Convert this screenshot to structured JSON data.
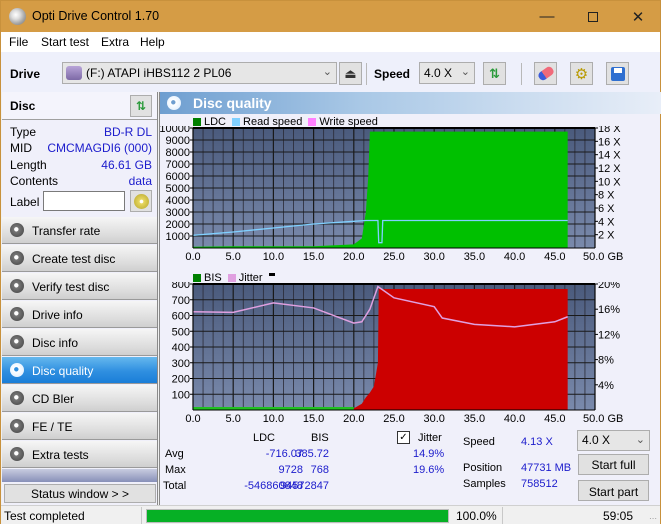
{
  "window": {
    "title": "Opti Drive Control 1.70",
    "controls": [
      "minimize",
      "maximize",
      "close"
    ]
  },
  "menu": [
    "File",
    "Start test",
    "Extra",
    "Help"
  ],
  "toolbar": {
    "drive_label": "Drive",
    "drive_value": "(F:)  ATAPI iHBS112  2 PL06",
    "speed_label": "Speed",
    "speed_value": "4.0 X",
    "icons": [
      "eject-icon",
      "refresh-icon",
      "erase-icon",
      "settings-icon",
      "save-icon"
    ]
  },
  "disc": {
    "header": "Disc",
    "rows": [
      {
        "key": "Type",
        "value": "BD-R DL"
      },
      {
        "key": "MID",
        "value": "CMCMAGDI6 (000)"
      },
      {
        "key": "Length",
        "value": "46.61 GB"
      },
      {
        "key": "Contents",
        "value": "data"
      }
    ],
    "label_key": "Label",
    "label_value": ""
  },
  "nav": [
    {
      "label": "Transfer rate",
      "active": false
    },
    {
      "label": "Create test disc",
      "active": false
    },
    {
      "label": "Verify test disc",
      "active": false
    },
    {
      "label": "Drive info",
      "active": false
    },
    {
      "label": "Disc info",
      "active": false
    },
    {
      "label": "Disc quality",
      "active": true
    },
    {
      "label": "CD Bler",
      "active": false
    },
    {
      "label": "FE / TE",
      "active": false
    },
    {
      "label": "Extra tests",
      "active": false
    }
  ],
  "status_window_label": "Status window > >",
  "panel": {
    "title": "Disc quality"
  },
  "chart_data": [
    {
      "type": "area",
      "title": "LDC / Read speed",
      "legend": [
        "LDC",
        "Read speed",
        "Write speed"
      ],
      "legend_colors": {
        "LDC": "#008000",
        "Read speed": "#80d0ff",
        "Write speed": "#ff80ff"
      },
      "legend_placement": "top-left",
      "xlabel": "GB",
      "x_ticks": [
        "0.0",
        "5.0",
        "10.0",
        "15.0",
        "20.0",
        "25.0",
        "30.0",
        "35.0",
        "40.0",
        "45.0",
        "50.0 GB"
      ],
      "xlim": [
        0,
        50
      ],
      "y_left_ticks": [
        "1000",
        "2000",
        "3000",
        "4000",
        "5000",
        "6000",
        "7000",
        "8000",
        "9000",
        "10000"
      ],
      "ylim_left": [
        0,
        10000
      ],
      "y_right_ticks": [
        "2 X",
        "4 X",
        "6 X",
        "8 X",
        "10 X",
        "12 X",
        "14 X",
        "16 X",
        "18 X"
      ],
      "ylim_right": [
        0,
        18
      ],
      "grid": true,
      "series": [
        {
          "name": "LDC",
          "x": [
            0,
            5,
            10,
            15,
            20,
            21,
            21.5,
            21.8,
            22,
            22.3,
            23,
            30,
            40,
            46.6
          ],
          "values": [
            100,
            150,
            150,
            150,
            300,
            800,
            3000,
            6000,
            9700,
            9700,
            9700,
            9700,
            9700,
            9700
          ]
        },
        {
          "name": "Read speed",
          "x": [
            0,
            5,
            10,
            15,
            20,
            21.5,
            23.0,
            23.1,
            23.5,
            23.6,
            30,
            40,
            46.6
          ],
          "values": [
            1.9,
            2.4,
            3.0,
            3.6,
            4.0,
            4.13,
            4.13,
            0.8,
            0.8,
            4.13,
            4.13,
            4.13,
            4.13
          ]
        }
      ]
    },
    {
      "type": "area",
      "title": "BIS / Jitter",
      "legend": [
        "BIS",
        "Jitter"
      ],
      "legend_colors": {
        "BIS": "#008000",
        "Jitter": "#e0a0e0"
      },
      "legend_placement": "top-left",
      "xlabel": "GB",
      "x_ticks": [
        "0.0",
        "5.0",
        "10.0",
        "15.0",
        "20.0",
        "25.0",
        "30.0",
        "35.0",
        "40.0",
        "45.0",
        "50.0 GB"
      ],
      "xlim": [
        0,
        50
      ],
      "y_left_ticks": [
        "100",
        "200",
        "300",
        "400",
        "500",
        "600",
        "700",
        "800"
      ],
      "ylim_left": [
        0,
        800
      ],
      "y_right_ticks": [
        "4%",
        "8%",
        "12%",
        "16%",
        "20%"
      ],
      "ylim_right": [
        0,
        20
      ],
      "grid": true,
      "series": [
        {
          "name": "BIS",
          "x": [
            0,
            20,
            21,
            21.5,
            22,
            22.5,
            23,
            23.1,
            46.6
          ],
          "values": [
            5,
            10,
            40,
            80,
            110,
            150,
            300,
            768,
            768
          ]
        },
        {
          "name": "Jitter",
          "x": [
            0,
            5,
            10,
            15,
            20,
            21,
            22,
            23,
            25,
            30,
            31,
            35,
            40,
            45,
            46.6
          ],
          "values": [
            15.6,
            15.5,
            17.0,
            16.2,
            13.8,
            14.0,
            16.0,
            19.6,
            17.8,
            16.4,
            14.6,
            13.6,
            13.2,
            14.0,
            14.8
          ]
        }
      ]
    }
  ],
  "stats": {
    "columns": [
      "LDC",
      "BIS"
    ],
    "jitter_label": "Jitter",
    "jitter_checked": true,
    "rows": [
      {
        "label": "Avg",
        "ldc": "-716.07",
        "bis": "385.72",
        "jitter": "14.9%"
      },
      {
        "label": "Max",
        "ldc": "9728",
        "bis": "768",
        "jitter": "19.6%"
      },
      {
        "label": "Total",
        "ldc": "-546860848",
        "bis": "94572847",
        "jitter": ""
      }
    ],
    "speed_label": "Speed",
    "speed_value": "4.13 X",
    "position_label": "Position",
    "position_value": "47731 MB",
    "samples_label": "Samples",
    "samples_value": "758512",
    "speed_select": "4.0 X",
    "start_full": "Start full",
    "start_part": "Start part"
  },
  "statusbar": {
    "text": "Test completed",
    "progress": 100.0,
    "progress_text": "100.0%",
    "time": "59:05"
  }
}
